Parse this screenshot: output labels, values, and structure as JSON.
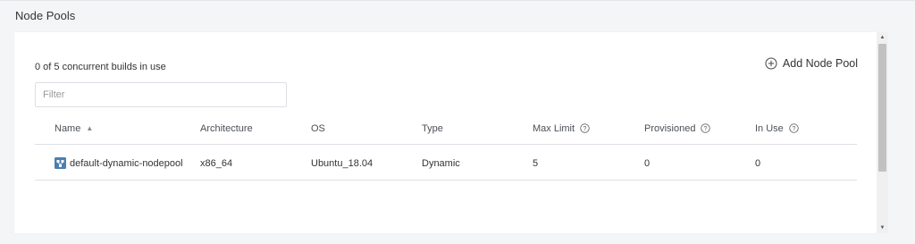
{
  "page": {
    "title": "Node Pools"
  },
  "panel": {
    "builds_status": "0 of 5 concurrent builds in use",
    "add_button_label": "Add Node Pool",
    "filter_placeholder": "Filter"
  },
  "table": {
    "columns": [
      {
        "label": "Name",
        "sortable": true,
        "help": false
      },
      {
        "label": "Architecture",
        "help": false
      },
      {
        "label": "OS",
        "help": false
      },
      {
        "label": "Type",
        "help": false
      },
      {
        "label": "Max Limit",
        "help": true
      },
      {
        "label": "Provisioned",
        "help": true
      },
      {
        "label": "In Use",
        "help": true
      }
    ],
    "rows": [
      {
        "name": "default-dynamic-nodepool",
        "architecture": "x86_64",
        "os": "Ubuntu_18.04",
        "type": "Dynamic",
        "max_limit": "5",
        "provisioned": "0",
        "in_use": "0",
        "icon": "node-pool-icon"
      }
    ]
  },
  "colors": {
    "accent": "#4a7fb0",
    "border": "#dcdfe4",
    "background": "#f4f5f7"
  }
}
